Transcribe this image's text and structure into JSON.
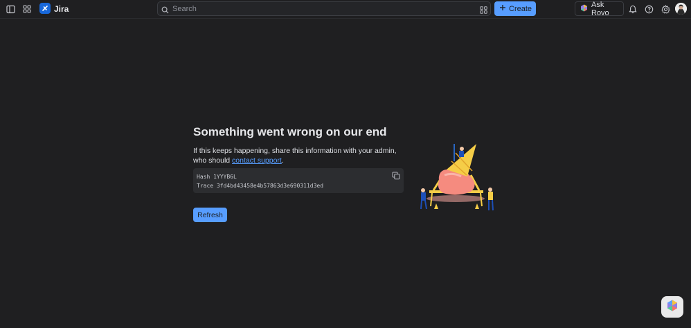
{
  "topbar": {
    "app_name": "Jira",
    "search_placeholder": "Search",
    "create_label": "Create",
    "rovo_label": "Ask Rovo",
    "icons": [
      "sidebar-toggle-icon",
      "app-switcher-icon",
      "jira-logo-icon",
      "search-icon",
      "filter-icon",
      "plus-icon",
      "rovo-icon",
      "bell-icon",
      "help-icon",
      "settings-icon"
    ]
  },
  "error": {
    "title": "Something went wrong on our end",
    "message_prefix": "If this keeps happening, share this information with your admin, who should ",
    "link_text": "contact support",
    "message_suffix": ".",
    "hash_line": "Hash 1YYYB6L",
    "trace_line": "Trace 3fd4bd43458e4b57863d3e690311d3ed",
    "refresh_label": "Refresh"
  },
  "colors": {
    "background": "#1f1f21",
    "accent": "#579dff",
    "brand": "#1868db"
  }
}
